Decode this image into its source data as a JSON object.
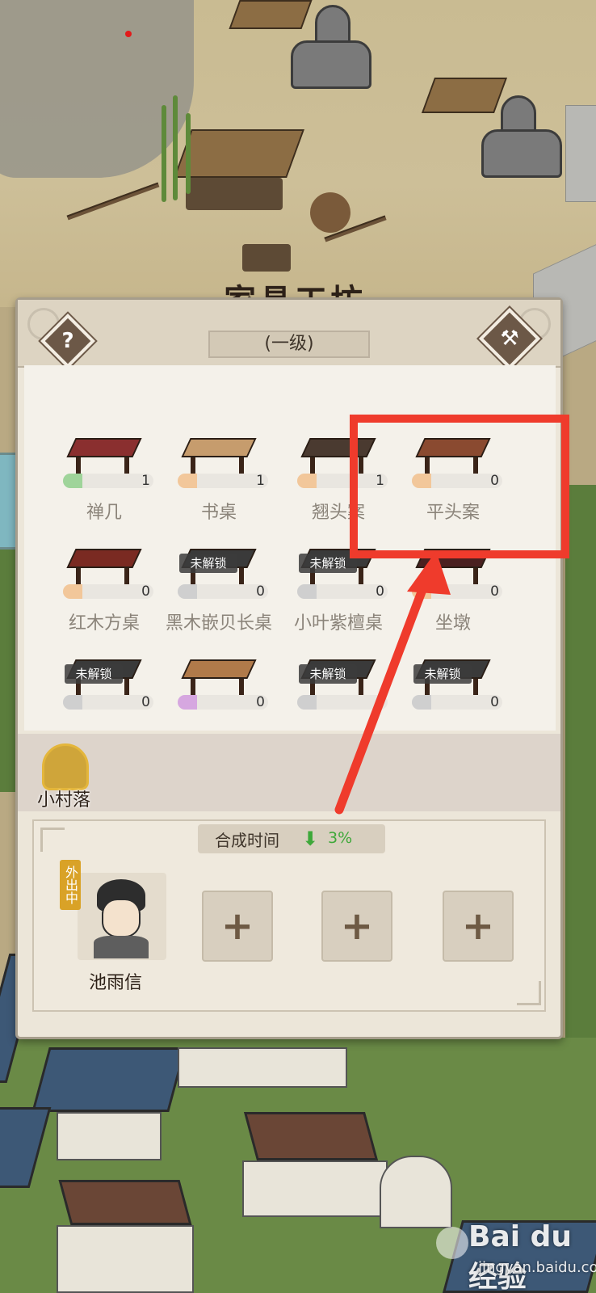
{
  "workshop": {
    "title": "家具工坊",
    "level": "(一级)",
    "help_icon": "question-icon",
    "build_icon": "hammer-icon"
  },
  "items": [
    {
      "name": "禅几",
      "count": "1",
      "locked": false,
      "bar_color": "#9fd49a"
    },
    {
      "name": "书桌",
      "count": "1",
      "locked": false,
      "bar_color": "#f2c79a"
    },
    {
      "name": "翘头案",
      "count": "1",
      "locked": false,
      "bar_color": "#f2c79a"
    },
    {
      "name": "平头案",
      "count": "0",
      "locked": false,
      "bar_color": "#f2c79a"
    },
    {
      "name": "红木方桌",
      "count": "0",
      "locked": false,
      "bar_color": "#f2c79a"
    },
    {
      "name": "黑木嵌贝长桌",
      "count": "0",
      "locked": true,
      "bar_color": "#cfcfcf"
    },
    {
      "name": "小叶紫檀桌",
      "count": "0",
      "locked": true,
      "bar_color": "#cfcfcf"
    },
    {
      "name": "坐墩",
      "count": "0",
      "locked": false,
      "bar_color": "#f2c79a"
    },
    {
      "name": "",
      "count": "0",
      "locked": true,
      "bar_color": "#cfcfcf"
    },
    {
      "name": "",
      "count": "0",
      "locked": false,
      "bar_color": "#d6a7e0"
    },
    {
      "name": "",
      "count": "0",
      "locked": true,
      "bar_color": "#cfcfcf"
    },
    {
      "name": "",
      "count": "0",
      "locked": true,
      "bar_color": "#cfcfcf"
    }
  ],
  "lock_label": "未解锁",
  "village": {
    "label": "小村落"
  },
  "synthesis": {
    "label": "合成时间",
    "bonus": "3%"
  },
  "worker": {
    "name": "池雨信",
    "status": "外出中"
  },
  "empty_slot_icon": "plus-icon",
  "watermark": {
    "brand": "Bai du经验",
    "url": "jingyan.baidu.com"
  },
  "colors": {
    "highlight": "#ef3b2c",
    "bonus_green": "#3ea83a",
    "status_gold": "#d9a227"
  }
}
